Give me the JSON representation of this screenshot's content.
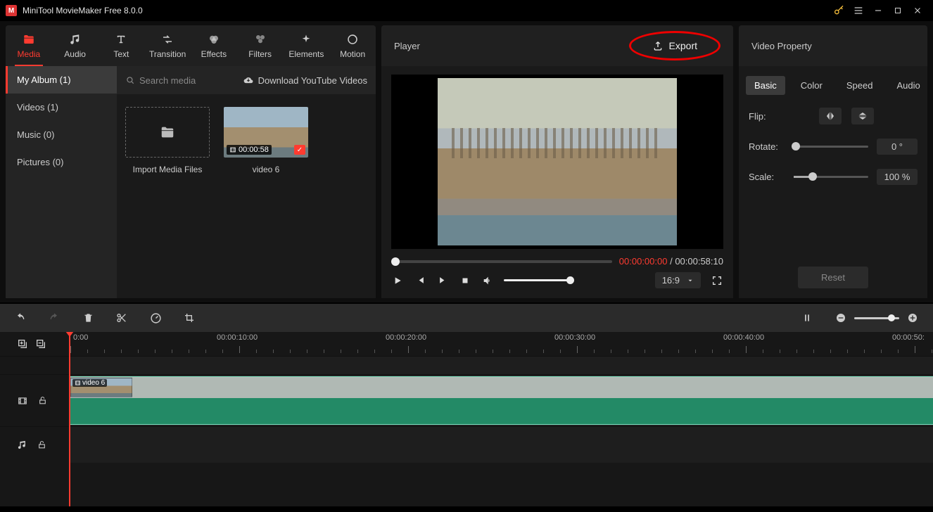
{
  "app": {
    "title": "MiniTool MovieMaker Free 8.0.0"
  },
  "mediaTabs": {
    "media": "Media",
    "audio": "Audio",
    "text": "Text",
    "transition": "Transition",
    "effects": "Effects",
    "filters": "Filters",
    "elements": "Elements",
    "motion": "Motion"
  },
  "mediaSide": {
    "myAlbum": "My Album (1)",
    "videos": "Videos (1)",
    "music": "Music (0)",
    "pictures": "Pictures (0)"
  },
  "mediaToolbar": {
    "search": "Search media",
    "ytLink": "Download YouTube Videos"
  },
  "thumbs": {
    "importLabel": "Import Media Files",
    "video1Label": "video 6",
    "video1Dur": "00:00:58"
  },
  "player": {
    "title": "Player",
    "export": "Export",
    "cur": "00:00:00:00",
    "total": "00:00:58:10",
    "aspect": "16:9"
  },
  "prop": {
    "title": "Video Property",
    "tabs": {
      "basic": "Basic",
      "color": "Color",
      "speed": "Speed",
      "audio": "Audio"
    },
    "flip": "Flip:",
    "rotate": "Rotate:",
    "rotateVal": "0 °",
    "scale": "Scale:",
    "scaleVal": "100 %",
    "reset": "Reset"
  },
  "ruler": {
    "t0": "0:00",
    "t1": "00:00:10:00",
    "t2": "00:00:20:00",
    "t3": "00:00:30:00",
    "t4": "00:00:40:00",
    "t5": "00:00:50:"
  },
  "clip": {
    "name": "video 6"
  }
}
